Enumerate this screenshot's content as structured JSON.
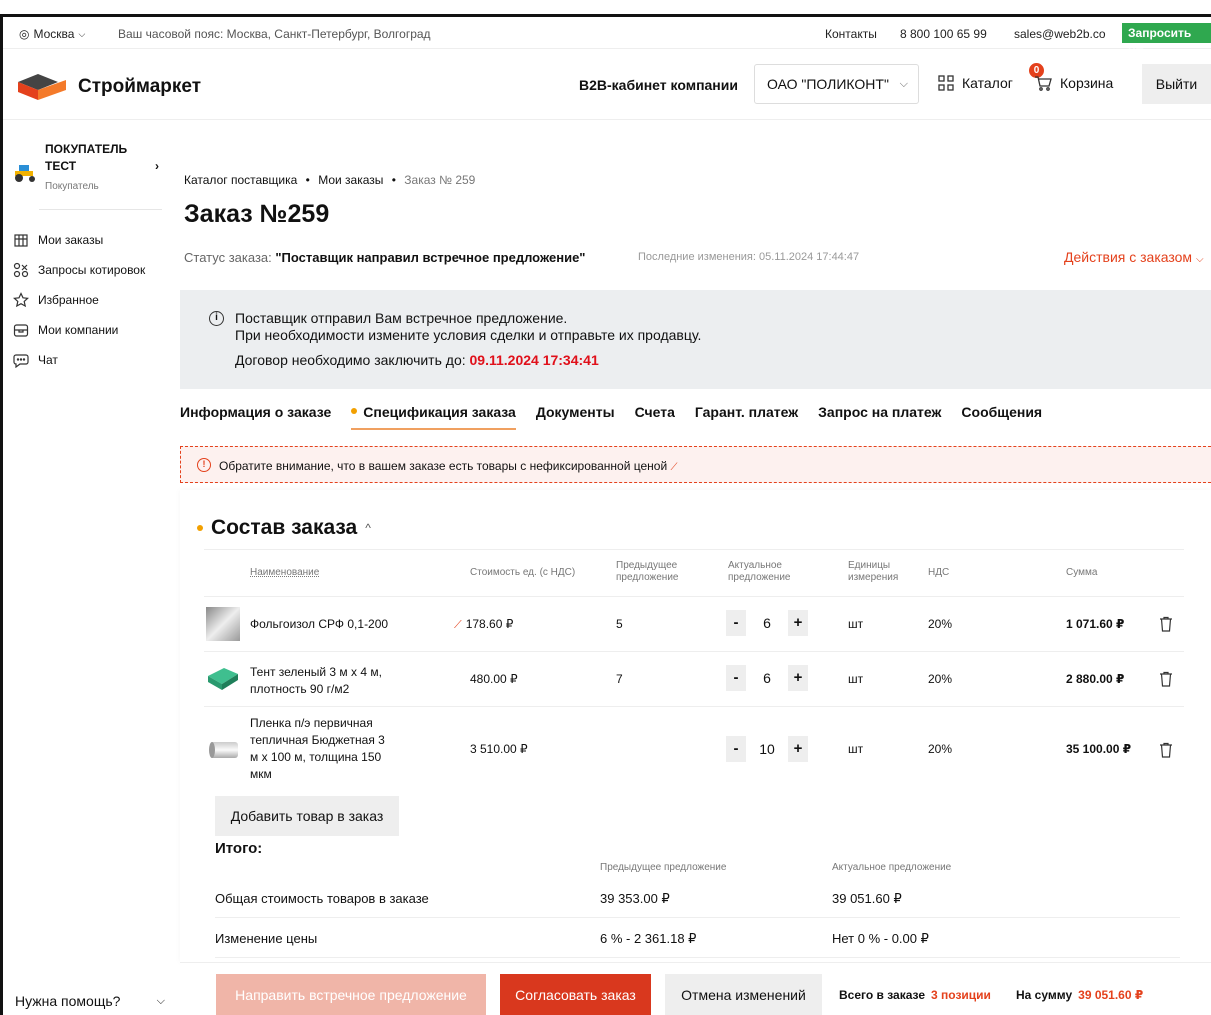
{
  "topbar": {
    "city": "Москва",
    "timezone": "Ваш часовой пояс: Москва, Санкт-Петербург, Волгоград",
    "contacts": "Контакты",
    "phone": "8 800 100 65 99",
    "email": "sales@web2b.co",
    "request_kp": "Запросить КП"
  },
  "header": {
    "logo": "Строймаркет",
    "b2b": "B2B-кабинет компании",
    "company": "ОАО \"ПОЛИКОНТ\"",
    "catalog": "Каталог",
    "cart": "Корзина",
    "cart_count": "0",
    "logout": "Выйти"
  },
  "sidebar": {
    "user_role_line1": "ПОКУПАТЕЛЬ",
    "user_role_line2": "ТЕСТ",
    "user_sub": "Покупатель",
    "items": [
      {
        "label": "Мои заказы",
        "icon": "orders-icon"
      },
      {
        "label": "Запросы котировок",
        "icon": "quotes-icon"
      },
      {
        "label": "Избранное",
        "icon": "star-icon"
      },
      {
        "label": "Мои компании",
        "icon": "companies-icon"
      },
      {
        "label": "Чат",
        "icon": "chat-icon"
      }
    ],
    "help": "Нужна помощь?"
  },
  "breadcrumbs": [
    "Каталог поставщика",
    "Мои заказы",
    "Заказ № 259"
  ],
  "order": {
    "title": "Заказ №259",
    "status_label": "Статус заказа:",
    "status_value": "\"Поставщик направил встречное предложение\"",
    "last_changed": "Последние изменения: 05.11.2024 17:44:47",
    "actions": "Действия с заказом"
  },
  "notice": {
    "line1": "Поставщик отправил Вам встречное предложение.",
    "line2": "При необходимости измените условия сделки и отправьте их продавцу.",
    "line3_label": "Договор необходимо заключить до:",
    "deadline": "09.11.2024 17:34:41"
  },
  "tabs": [
    {
      "label": "Информация о заказе"
    },
    {
      "label": "Спецификация заказа"
    },
    {
      "label": "Документы"
    },
    {
      "label": "Счета"
    },
    {
      "label": "Гарант. платеж"
    },
    {
      "label": "Запрос на платеж"
    },
    {
      "label": "Сообщения"
    }
  ],
  "warning": "Обратите внимание, что в вашем заказе есть товары с нефиксированной ценой",
  "composition": {
    "title": "Состав заказа",
    "columns": {
      "name": "Наименование",
      "unit_price": "Стоимость ед. (с НДС)",
      "prev_line1": "Предыдущее",
      "prev_line2": "предложение",
      "act_line1": "Актуальное",
      "act_line2": "предложение",
      "units_line1": "Единицы",
      "units_line2": "измерения",
      "vat": "НДС",
      "sum": "Сумма"
    },
    "rows": [
      {
        "name": [
          "Фольгоизол СРФ 0,1-200"
        ],
        "price": "178.60 ₽",
        "prev": "5",
        "qty": "6",
        "unit": "шт",
        "vat": "20%",
        "sum": "1 071.60 ₽"
      },
      {
        "name": [
          "Тент зеленый 3 м x 4 м,",
          "плотность 90 г/м2"
        ],
        "price": "480.00 ₽",
        "prev": "7",
        "qty": "6",
        "unit": "шт",
        "vat": "20%",
        "sum": "2 880.00 ₽"
      },
      {
        "name": [
          "Пленка п/э первичная",
          "тепличная Бюджетная 3",
          "м x 100 м, толщина 150",
          "мкм"
        ],
        "price": "3 510.00 ₽",
        "prev": "",
        "qty": "10",
        "unit": "шт",
        "vat": "20%",
        "sum": "35 100.00 ₽"
      }
    ],
    "add_button": "Добавить товар в заказ",
    "total_title": "Итого:",
    "prev_header": "Предыдущее предложение",
    "act_header": "Актуальное предложение",
    "summary": [
      {
        "label": "Общая стоимость товаров в заказе",
        "prev": "39 353.00 ₽",
        "act": "39 051.60 ₽"
      },
      {
        "label": "Изменение цены",
        "prev": "6 % - 2 361.18 ₽",
        "act": "Нет 0 % - 0.00 ₽"
      }
    ]
  },
  "footer": {
    "send_counter": "Направить встречное предложение",
    "approve": "Согласовать заказ",
    "cancel_changes": "Отмена изменений",
    "total_label": "Всего в заказе",
    "total_value": "3 позиции",
    "sum_label": "На сумму",
    "sum_value": "39 051.60 ₽"
  },
  "colors": {
    "accent": "#e4411c",
    "approve_button": "#d9381e",
    "green": "#2fa84f",
    "bullet": "#f2a000"
  }
}
